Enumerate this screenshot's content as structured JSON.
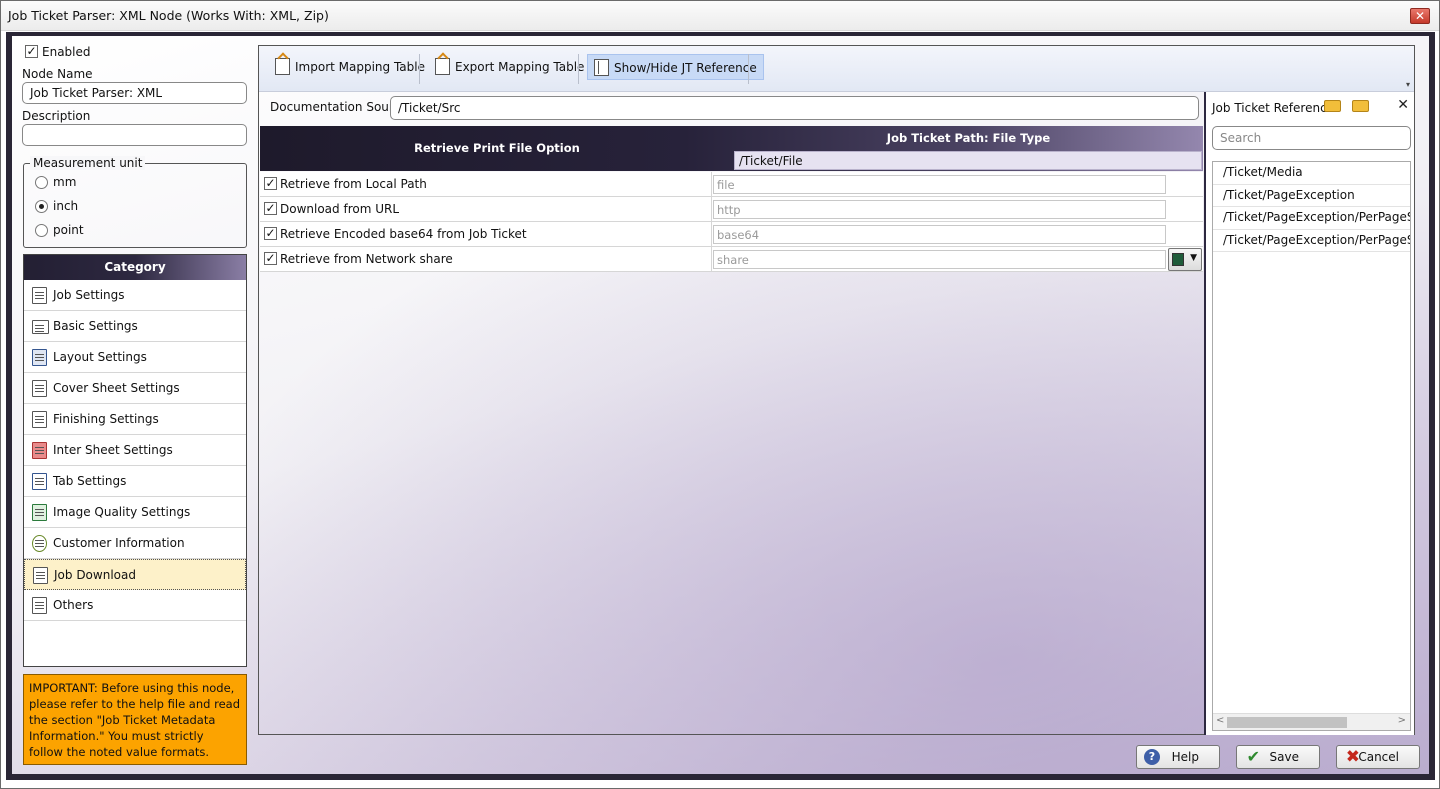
{
  "window": {
    "title": "Job Ticket Parser: XML Node (Works With: XML, Zip)",
    "close_glyph": "✕"
  },
  "left": {
    "enabled_label": "Enabled",
    "enabled_checked": true,
    "node_name_label": "Node Name",
    "node_name_value": "Job Ticket Parser: XML",
    "description_label": "Description",
    "description_value": "",
    "measurement": {
      "legend": "Measurement unit",
      "options": [
        "mm",
        "inch",
        "point"
      ],
      "selected": "inch"
    },
    "category": {
      "header": "Category",
      "items": [
        {
          "label": "Job Settings",
          "icon": "document-icon"
        },
        {
          "label": "Basic Settings",
          "icon": "list-icon"
        },
        {
          "label": "Layout Settings",
          "icon": "layout-icon"
        },
        {
          "label": "Cover Sheet Settings",
          "icon": "cover-sheet-icon"
        },
        {
          "label": "Finishing Settings",
          "icon": "finishing-icon"
        },
        {
          "label": "Inter Sheet Settings",
          "icon": "inter-sheet-icon"
        },
        {
          "label": "Tab Settings",
          "icon": "tab-icon"
        },
        {
          "label": "Image Quality Settings",
          "icon": "image-quality-icon"
        },
        {
          "label": "Customer Information",
          "icon": "customer-icon"
        },
        {
          "label": "Job Download",
          "icon": "job-download-icon"
        },
        {
          "label": "Others",
          "icon": "others-icon"
        }
      ],
      "selected": "Job Download"
    },
    "note": "IMPORTANT: Before using this node, please refer to the help file and read the section \"Job Ticket Metadata Information.\" You must strictly follow the noted value formats."
  },
  "toolbar": {
    "import_label": "Import Mapping Table",
    "export_label": "Export Mapping Table",
    "showhide_label": "Show/Hide JT Reference",
    "overflow_glyph": "▾"
  },
  "doc_source": {
    "label": "Documentation Source",
    "value": "/Ticket/Src"
  },
  "grid": {
    "col1_header": "Retrieve Print File Option",
    "col2_header": "Job Ticket Path: File Type",
    "col2_value": "/Ticket/File",
    "rows": [
      {
        "label": "Retrieve from Local Path",
        "checked": true,
        "placeholder": "file"
      },
      {
        "label": "Download from URL",
        "checked": true,
        "placeholder": "http"
      },
      {
        "label": "Retrieve Encoded base64 from Job Ticket",
        "checked": true,
        "placeholder": "base64"
      },
      {
        "label": "Retrieve from Network share",
        "checked": true,
        "placeholder": "share"
      }
    ],
    "check_glyph": "✓",
    "picker_arrow": "▼"
  },
  "reference": {
    "title": "Job Ticket Reference",
    "close_glyph": "✕",
    "search_placeholder": "Search",
    "items": [
      "/Ticket/Media",
      "/Ticket/PageException",
      "/Ticket/PageException/PerPageSetting",
      "/Ticket/PageException/PerPageSetting"
    ],
    "scroll_left": "<",
    "scroll_right": ">"
  },
  "buttons": {
    "help_label": "Help",
    "save_label": "Save",
    "cancel_label": "Cancel",
    "help_glyph": "?",
    "save_glyph": "✔",
    "cancel_glyph": "✖"
  },
  "colors": {
    "accent": "#2d2840",
    "selected_item": "#fdf1c9",
    "note_bg": "#fca300",
    "toolbar_active": "#c8daf6"
  }
}
